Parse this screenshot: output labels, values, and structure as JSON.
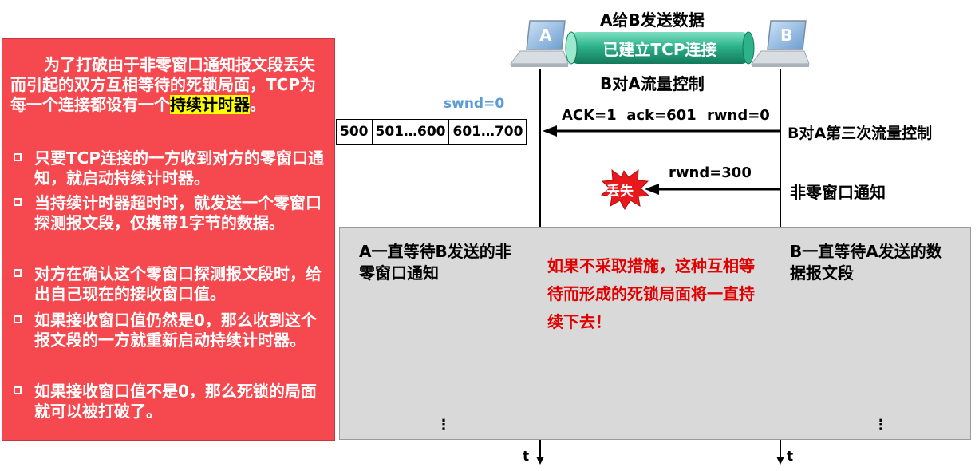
{
  "header": {
    "top_label": "A给B发送数据",
    "tube_label": "已建立TCP连接",
    "bottom_label": "B对A流量控制"
  },
  "hosts": {
    "a_label": "A",
    "b_label": "B"
  },
  "colors": {
    "panel_red": "#f5484f",
    "tube_green": "#2db38a",
    "swnd_blue": "#5b9bd5",
    "warning_red": "#e00000",
    "gray_zone": "#d9d9d9"
  },
  "left_panel": {
    "intro_before": "为了打破由于非零窗口通知报文段丢失而引起的双方互相等待的死锁局面，TCP为每一个连接都设有一个",
    "intro_highlight": "持续计时器",
    "intro_after": "。",
    "bullets": [
      "只要TCP连接的一方收到对方的零窗口通知，就启动持续计时器。",
      "当持续计时器超时时，就发送一个零窗口探测报文段，仅携带1字节的数据。",
      "对方在确认这个零窗口探测报文段时，给出自己现在的接收窗口值。",
      "如果接收窗口值仍然是0，那么收到这个报文段的一方就重新启动持续计时器。",
      "如果接收窗口值不是0，那么死锁的局面就可以被打破了。"
    ]
  },
  "buffer": {
    "swnd_label": "swnd=0",
    "cells": [
      "500",
      "501…600",
      "601…700"
    ]
  },
  "messages": {
    "ack_text": "ACK=1  ack=601",
    "rwnd0_text": "rwnd=0",
    "third_flow_control": "B对A第三次流量控制",
    "rwnd300_text": "rwnd=300",
    "nonzero_notice": "非零窗口通知",
    "lost_label": "丢失"
  },
  "wait_zone": {
    "a_wait": "A一直等待B发送的非零窗口通知",
    "warning": "如果不采取措施，这种互相等待而形成的死锁局面将一直持续下去！",
    "b_wait": "B一直等待A发送的数据报文段",
    "ellipsis_a": "⋮",
    "ellipsis_b": "⋮"
  },
  "timeline": {
    "a_t_label": "t",
    "b_t_label": "t"
  }
}
